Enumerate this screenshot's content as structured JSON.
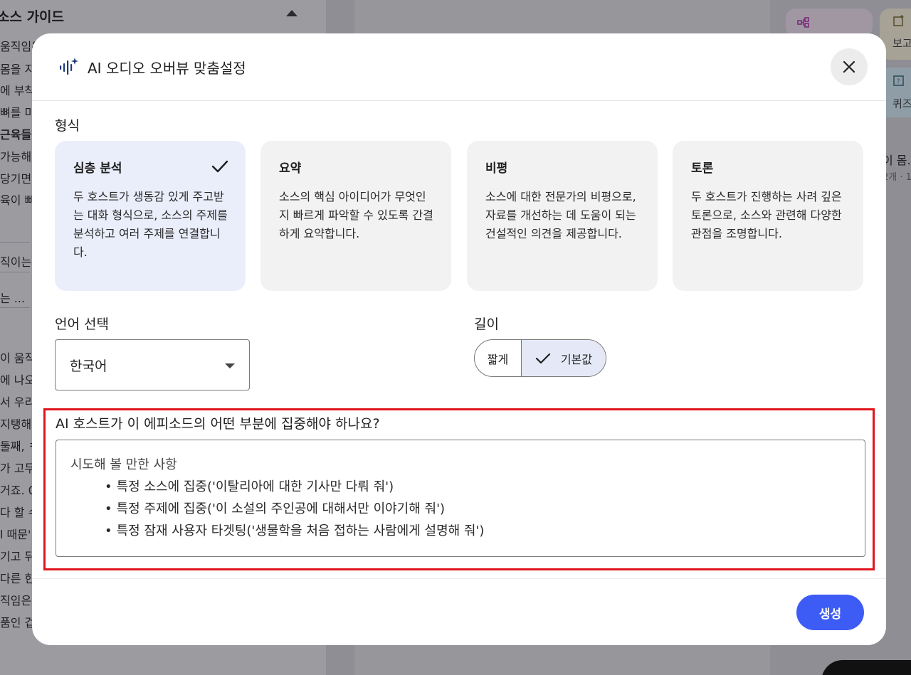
{
  "background": {
    "left_panel_title": "소스 가이드",
    "left_lines": [
      {
        "text": "움직임은",
        "bold": false
      },
      {
        "text": "몸을 지",
        "bold": false
      },
      {
        "text": "에 부착",
        "bold": false
      },
      {
        "text": "뼈를 미",
        "bold": false
      },
      {
        "text": "근육들",
        "bold": true
      },
      {
        "text": "가능해",
        "bold": false
      },
      {
        "text": "당기면",
        "bold": false
      },
      {
        "text": "육이 빠",
        "bold": false
      }
    ],
    "left_short_lines": [
      "직이는 ...",
      "는 ..."
    ],
    "left_lower_lines": [
      "이 움직",
      "에 나오",
      "서 우리",
      "지탱해",
      "둘째, ㅋ",
      "가 고무",
      "거죠. 0",
      "다 할 수",
      "l 때문'",
      "기고 뒤",
      "다른 한",
      "직임은",
      "품인 겁"
    ],
    "right_items": [
      "보고",
      "퀴즈",
      "이 몸.",
      "2개 · 1"
    ]
  },
  "modal": {
    "title": "AI 오디오 오버뷰 맞춤설정",
    "format_label": "형식",
    "formats": [
      {
        "title": "심층 분석",
        "desc": "두 호스트가 생동감 있게 주고받는 대화 형식으로, 소스의 주제를 분석하고 여러 주제를 연결합니다.",
        "selected": true
      },
      {
        "title": "요약",
        "desc": "소스의 핵심 아이디어가 무엇인지 빠르게 파악할 수 있도록 간결하게 요약합니다.",
        "selected": false
      },
      {
        "title": "비평",
        "desc": "소스에 대한 전문가의 비평으로, 자료를 개선하는 데 도움이 되는 건설적인 의견을 제공합니다.",
        "selected": false
      },
      {
        "title": "토론",
        "desc": "두 호스트가 진행하는 사려 깊은 토론으로, 소스와 관련해 다양한 관점을 조명합니다.",
        "selected": false
      }
    ],
    "language_label": "언어 선택",
    "language_value": "한국어",
    "length_label": "길이",
    "length_options": {
      "short": "짧게",
      "default": "기본값"
    },
    "focus_question": "AI 호스트가 이 에피소드의 어떤 부분에 집중해야 하나요?",
    "focus_placeholder_head": "시도해 볼 만한 사항",
    "focus_placeholder_items": [
      "특정 소스에 집중('이탈리아에 대한 기사만 다뤄 줘')",
      "특정 주제에 집중('이 소설의 주인공에 대해서만 이야기해 줘')",
      "특정 잠재 사용자 타겟팅('생물학을 처음 접하는 사람에게 설명해 줘')"
    ],
    "generate_label": "생성"
  },
  "colors": {
    "accent": "#3d5cf5",
    "highlight_border": "#e0141c",
    "selected_card": "#eaedfa",
    "overlay": "#8f8e94"
  },
  "icons": {
    "title": "audio-sparkle-icon",
    "close": "close-icon",
    "check": "checkmark-icon",
    "dropdown": "dropdown-arrow-icon"
  }
}
